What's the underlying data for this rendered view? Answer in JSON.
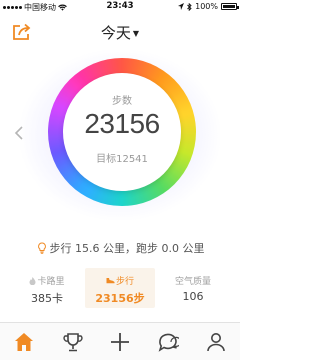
{
  "status_bar": {
    "carrier": "中国移动",
    "time": "23:43",
    "battery_text": "100%",
    "battery_level": 1.0
  },
  "header": {
    "title": "今天",
    "share_icon": "share-icon",
    "dropdown_icon": "caret-down-icon"
  },
  "ring": {
    "label": "步数",
    "steps": "23156",
    "goal": "目标12541"
  },
  "summary": {
    "icon": "lightbulb-icon",
    "text": "步行 15.6 公里，跑步 0.0 公里"
  },
  "stats": [
    {
      "label": "卡路里",
      "value": "385卡",
      "icon": "flame-icon"
    },
    {
      "label": "步行",
      "value": "23156步",
      "icon": "shoe-icon"
    },
    {
      "label": "空气质量",
      "value": "106",
      "icon": ""
    }
  ],
  "tabbar": {
    "items": [
      "home-icon",
      "trophy-icon",
      "plus-icon",
      "chat-icon",
      "person-icon"
    ]
  },
  "colors": {
    "accent": "#f08a24",
    "text_muted": "#9a9a9a",
    "tab_active": "#f08a24",
    "tab_inactive": "#444444"
  }
}
